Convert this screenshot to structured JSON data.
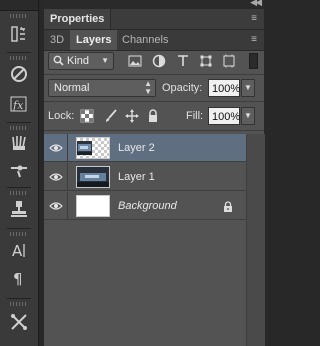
{
  "panel": {
    "properties_tab": "Properties",
    "tabs": [
      {
        "label": "3D",
        "active": false
      },
      {
        "label": "Layers",
        "active": true
      },
      {
        "label": "Channels",
        "active": false
      }
    ]
  },
  "filter": {
    "kind_label": "Kind",
    "icons": [
      "pixel-layer-filter-icon",
      "adjustment-layer-filter-icon",
      "type-layer-filter-icon",
      "shape-layer-filter-icon",
      "smart-object-filter-icon"
    ]
  },
  "blend": {
    "mode": "Normal",
    "opacity_label": "Opacity:",
    "opacity_value": "100%",
    "fill_label": "Fill:",
    "fill_value": "100%"
  },
  "lock": {
    "label": "Lock:",
    "icons": [
      "lock-transparent-pixels-icon",
      "lock-image-pixels-icon",
      "lock-position-icon",
      "lock-all-icon"
    ]
  },
  "layers": [
    {
      "name": "Layer 2",
      "selected": true,
      "visible": true,
      "italic": false,
      "locked": false
    },
    {
      "name": "Layer 1",
      "selected": false,
      "visible": true,
      "italic": false,
      "locked": false
    },
    {
      "name": "Background",
      "selected": false,
      "visible": true,
      "italic": true,
      "locked": true
    }
  ],
  "colors": {
    "panel_bg": "#535353",
    "selected_row": "#5f6e80",
    "dark_bg": "#282828"
  }
}
